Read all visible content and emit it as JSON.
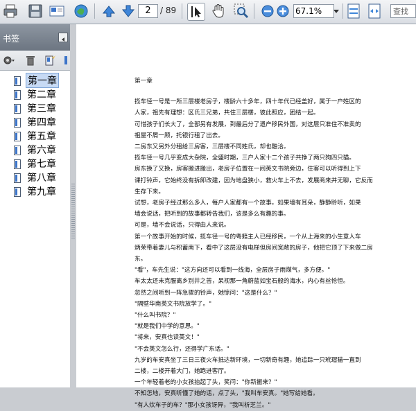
{
  "toolbar": {
    "page_current": "2",
    "page_total": "/ 89",
    "zoom": "67.1%",
    "search_placeholder": "查找",
    "icons": [
      "print-icon",
      "save-icon",
      "email-icon",
      "collaborate-icon",
      "previous-page-icon",
      "next-page-icon",
      "select-tool-icon",
      "hand-tool-icon",
      "marquee-zoom-icon",
      "zoom-out-icon",
      "zoom-in-icon",
      "zoom-dropdown-icon",
      "fit-page-icon",
      "fit-width-icon"
    ]
  },
  "sidebar": {
    "title": "书签",
    "bookmarks": [
      {
        "label": "第一章",
        "selected": true
      },
      {
        "label": "第二章"
      },
      {
        "label": "第三章"
      },
      {
        "label": "第四章"
      },
      {
        "label": "第五章"
      },
      {
        "label": "第六章"
      },
      {
        "label": "第七章"
      },
      {
        "label": "第八章"
      },
      {
        "label": "第九章"
      }
    ]
  },
  "document": {
    "heading": "第一章",
    "lines": [
      "    揽车径一号是一所三层楼老房子，楼龄六十多年，四十年代已经盖好，属于一户姓区的",
      "人家，祖先有理想：区氏三兄弟，共住三层楼，彼此照应，团结一起。",
      "    可惜孩子们长大了，全部另有发展，到最后分了遗产移民外国，对这层只准住不准卖的",
      "祖屋不屑一顾，托银行租了出去。",
      "    二房东又另外分租给三房客，三层楼不同姓氏，却也融洽。",
      "    揽车径一号几乎变成大杂院，全盛时期，三户人家十二个孩子共挣了两只狗四只猫。",
      "    房东换了又换，房客搬进搬出，老房子位置在一间英文书院旁边，住客可以听得到上下",
      "课打铃声，它始终没有拆卸改建，因为地盘狭小，救火车上不去，发展商来并无聊，它反而",
      "生存下来。",
      "    试想，老房子经过那么多人，每户人家都有一个故事，如果墙有耳朵，静静聆听，如果",
      "墙会说话，把听到的故事都转告我们，该是多么有趣的事。",
      "    可是，墙不会说话，只得由人来说。",
      "    第一个故事开始的时候，揽车径一号的粤籍主人已经移民，一个从上海来的小生意人车",
      "炳荣带着妻儿与积蓄南下，看中了这层没有电梯但房间宽敞的房子，他把它顶了下来做二房",
      "东。",
      "    \"看\"，车先生说：\"这方向还可以看到一线海，全层房子雨煤气，多方便。\"",
      "    车太太还未克服离乡别井之苦，呆视那一角蔚蓝如宝石般的海水，内心有丝怆怛。",
      "    忽然之间听到一阵急骤的铃声，她惊问：\"这是什么？\"",
      "    \"隔壁华南英文书院放学了。\"",
      "    \"什么叫书院？\"",
      "    \"就是我们中学的意思。\"",
      "    \"将来，安真也读英文！\"",
      "    \"不会英文怎么行，还得学广东话。\"",
      "    九岁的车安真坐了三日三夜火车抵达新环境，一切新奇有趣，她追踪一只玳瑁猫一直到",
      "二楼，二楼开着大门，她跑进客厅。",
      "    一个年轻着老的小女孩抬起了头，笑问：\"你新搬来？\"",
      "    不知怎地，安真听懂了她的话，点了头，\"我叫车安真。\"她写给她看。",
      "    \"有人炊车子的车？\"那小女孩讶异，\"我叫析芝兰。\""
    ]
  }
}
